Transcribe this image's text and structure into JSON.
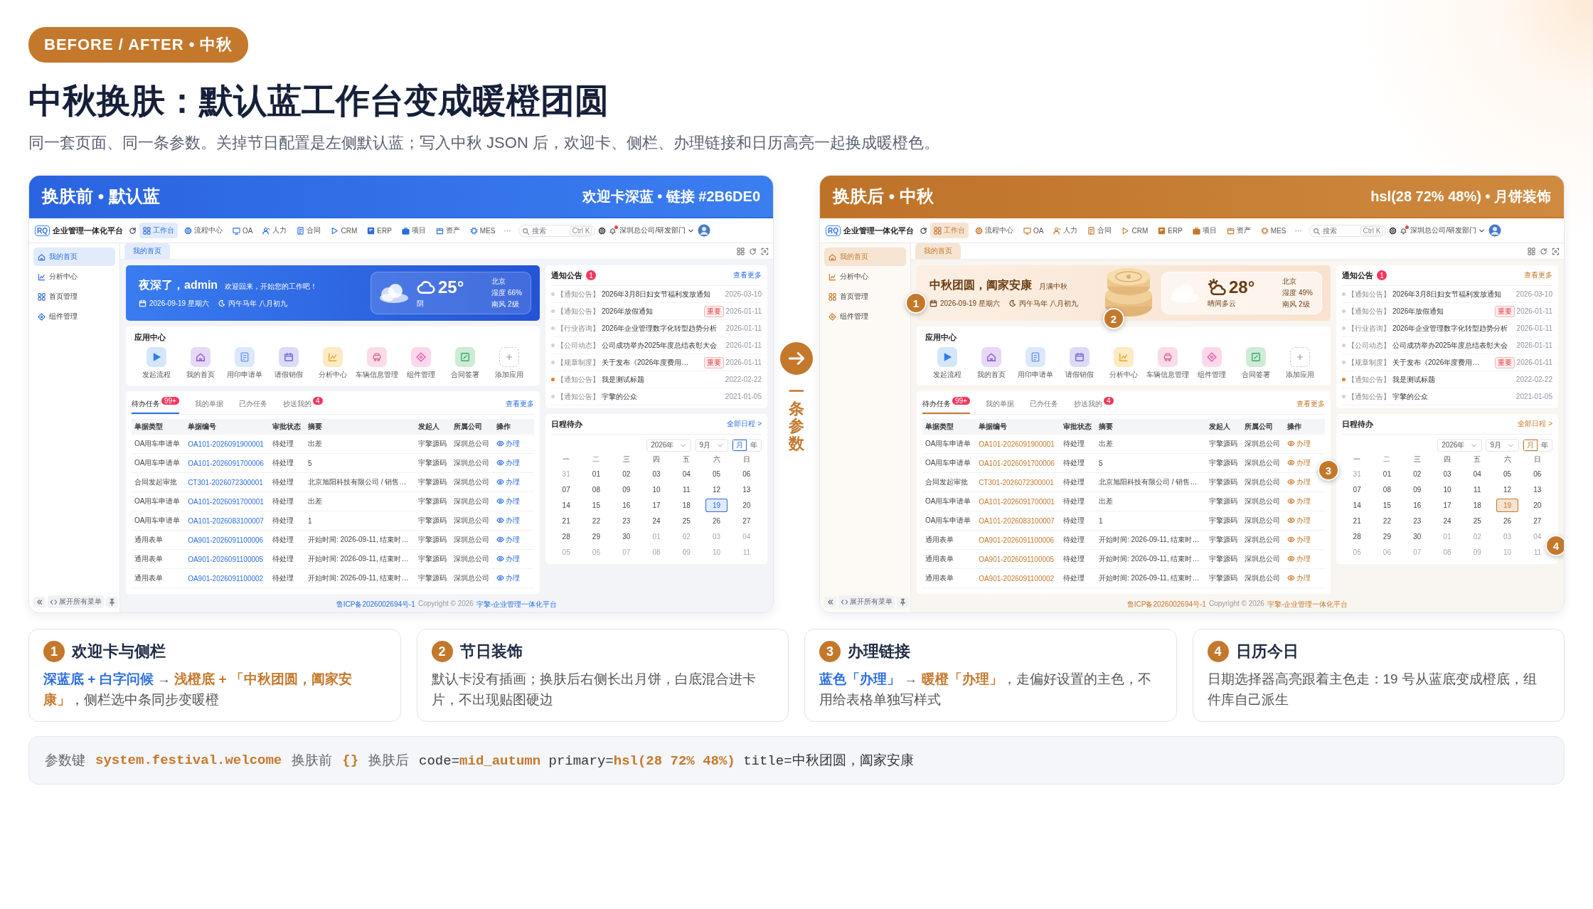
{
  "badge": "BEFORE / AFTER • 中秋",
  "title": "中秋换肤：默认蓝工作台变成暖橙团圆",
  "subtitle": "同一套页面、同一条参数。关掉节日配置是左侧默认蓝；写入中秋 JSON 后，欢迎卡、侧栏、办理链接和日历高亮一起换成暖橙色。",
  "connector": {
    "label": "一条参数"
  },
  "panels": [
    {
      "kind": "default",
      "header": {
        "title": "换肤前 • 默认蓝",
        "note": "欢迎卡深蓝 • 链接 #2B6DE0"
      },
      "app": {
        "logo": "RQ",
        "name": "企业管理一体化平台",
        "nav": [
          {
            "label": "工作台",
            "selected": true
          },
          {
            "label": "流程中心",
            "selected": false
          },
          {
            "label": "OA",
            "selected": false
          },
          {
            "label": "人力",
            "selected": false
          },
          {
            "label": "合同",
            "selected": false
          },
          {
            "label": "CRM",
            "selected": false
          },
          {
            "label": "ERP",
            "selected": false
          },
          {
            "label": "项目",
            "selected": false
          },
          {
            "label": "资产",
            "selected": false
          },
          {
            "label": "MES",
            "selected": false
          }
        ],
        "more": "···",
        "search": {
          "placeholder": "搜索",
          "shortcut": "Ctrl K"
        },
        "org": "深圳总公司/研发部门",
        "sidebar": [
          {
            "label": "我的首页",
            "selected": true
          },
          {
            "label": "分析中心",
            "selected": false
          },
          {
            "label": "首页管理",
            "selected": false
          },
          {
            "label": "组件管理",
            "selected": false
          }
        ],
        "sidebar_footer": "展开所有菜单",
        "page_tabs": [
          {
            "label": "我的首页",
            "selected": true
          }
        ],
        "welcome": {
          "greeting": "夜深了，admin",
          "message": "欢迎回来，开始您的工作吧！",
          "date": "2026-09-19 星期六",
          "lunar": "丙午马年 八月初九",
          "weather": {
            "kind": "cloudy",
            "temp": "25°",
            "desc": "阴",
            "city": "北京",
            "humidity": "湿度 66%",
            "wind": "南风 2级"
          }
        },
        "apps": {
          "title": "应用中心",
          "items": [
            {
              "label": "发起流程",
              "kind": "app",
              "color": "#d3e6fb"
            },
            {
              "label": "我的首页",
              "kind": "app",
              "color": "#e6d8f6"
            },
            {
              "label": "用印申请单",
              "kind": "app",
              "color": "#dce8fc"
            },
            {
              "label": "请假销假",
              "kind": "app",
              "color": "#dcdaf7"
            },
            {
              "label": "分析中心",
              "kind": "app",
              "color": "#fcebc3"
            },
            {
              "label": "车辆信息管理",
              "kind": "app",
              "color": "#fbdbe7"
            },
            {
              "label": "组件管理",
              "kind": "app",
              "color": "#fbd8ec"
            },
            {
              "label": "合同签署",
              "kind": "app",
              "color": "#cdebd7"
            },
            {
              "label": "添加应用",
              "kind": "add"
            }
          ]
        },
        "tasks": {
          "tabs": [
            {
              "label": "待办任务",
              "badge": "99+",
              "selected": true
            },
            {
              "label": "我的单据",
              "selected": false
            },
            {
              "label": "已办任务",
              "selected": false
            },
            {
              "label": "抄送我的",
              "badge": "4",
              "selected": false
            }
          ],
          "more": "查看更多",
          "columns": [
            "单据类型",
            "单据编号",
            "审批状态",
            "摘要",
            "发起人",
            "所属公司",
            "操作"
          ],
          "rows": [
            {
              "cells": [
                "OA用车申请单",
                "OA101-2026091900001",
                "待处理",
                "出差",
                "宇擎源码",
                "深圳总公司"
              ],
              "action": "办理"
            },
            {
              "cells": [
                "OA用车申请单",
                "OA101-2026091700006",
                "待处理",
                "5",
                "宇擎源码",
                "深圳总公司"
              ],
              "action": "办理"
            },
            {
              "cells": [
                "合同发起审批",
                "CT301-2026072300001",
                "待处理",
                "北京旭阳科技有限公司 / 销售…",
                "宇擎源码",
                "深圳总公司"
              ],
              "action": "办理"
            },
            {
              "cells": [
                "OA用车申请单",
                "OA101-2026091700001",
                "待处理",
                "出差",
                "宇擎源码",
                "深圳总公司"
              ],
              "action": "办理"
            },
            {
              "cells": [
                "OA用车申请单",
                "OA101-2026083100007",
                "待处理",
                "1",
                "宇擎源码",
                "深圳总公司"
              ],
              "action": "办理"
            },
            {
              "cells": [
                "通用表单",
                "OA901-2026091100006",
                "待处理",
                "开始时间: 2026-09-11, 结束时…",
                "宇擎源码",
                "深圳总公司"
              ],
              "action": "办理"
            },
            {
              "cells": [
                "通用表单",
                "OA901-2026091100005",
                "待处理",
                "开始时间: 2026-09-11, 结束时…",
                "宇擎源码",
                "深圳总公司"
              ],
              "action": "办理"
            },
            {
              "cells": [
                "通用表单",
                "OA901-2026091100002",
                "待处理",
                "开始时间: 2026-09-11, 结束时…",
                "宇擎源码",
                "深圳总公司"
              ],
              "action": "办理"
            }
          ]
        },
        "notices": {
          "title": "通知公告",
          "badge": "1",
          "more": "查看更多",
          "items": [
            {
              "category": "【通知公告】",
              "title": "2026年3月8日妇女节福利发放通知",
              "date": "2026-03-10",
              "highlighted": false
            },
            {
              "category": "【通知公告】",
              "title": "2026年放假通知",
              "tag": "重要",
              "date": "2026-01-11",
              "highlighted": false
            },
            {
              "category": "【行业咨询】",
              "title": "2026年企业管理数字化转型趋势分析",
              "date": "2026-01-11",
              "highlighted": false
            },
            {
              "category": "【公司动态】",
              "title": "公司成功举办2025年度总结表彰大会",
              "date": "2026-01-11",
              "highlighted": false
            },
            {
              "category": "【规章制度】",
              "title": "关于发布《2026年度费用…",
              "tag": "重要",
              "date": "2026-01-11",
              "highlighted": false
            },
            {
              "category": "【通知公告】",
              "title": "我是测试标题",
              "date": "2022-02-22",
              "highlighted": true
            },
            {
              "category": "【通知公告】",
              "title": "宇擎的公众",
              "date": "2021-01-05",
              "highlighted": false
            }
          ]
        },
        "calendar": {
          "title": "日程待办",
          "more": "全部日程 >",
          "year": "2026年",
          "month": "9月",
          "modes": [
            {
              "label": "月",
              "selected": true
            },
            {
              "label": "年",
              "selected": false
            }
          ],
          "weekdays": [
            "一",
            "二",
            "三",
            "四",
            "五",
            "六",
            "日"
          ],
          "weeks": [
            [
              {
                "label": "31",
                "muted": true,
                "selected": false
              },
              {
                "label": "01",
                "muted": false,
                "selected": false
              },
              {
                "label": "02",
                "muted": false,
                "selected": false
              },
              {
                "label": "03",
                "muted": false,
                "selected": false
              },
              {
                "label": "04",
                "muted": false,
                "selected": false
              },
              {
                "label": "05",
                "muted": false,
                "selected": false
              },
              {
                "label": "06",
                "muted": false,
                "selected": false
              }
            ],
            [
              {
                "label": "07",
                "muted": false,
                "selected": false
              },
              {
                "label": "08",
                "muted": false,
                "selected": false
              },
              {
                "label": "09",
                "muted": false,
                "selected": false
              },
              {
                "label": "10",
                "muted": false,
                "selected": false
              },
              {
                "label": "11",
                "muted": false,
                "selected": false
              },
              {
                "label": "12",
                "muted": false,
                "selected": false
              },
              {
                "label": "13",
                "muted": false,
                "selected": false
              }
            ],
            [
              {
                "label": "14",
                "muted": false,
                "selected": false
              },
              {
                "label": "15",
                "muted": false,
                "selected": false
              },
              {
                "label": "16",
                "muted": false,
                "selected": false
              },
              {
                "label": "17",
                "muted": false,
                "selected": false
              },
              {
                "label": "18",
                "muted": false,
                "selected": false
              },
              {
                "label": "19",
                "muted": false,
                "selected": true
              },
              {
                "label": "20",
                "muted": false,
                "selected": false
              }
            ],
            [
              {
                "label": "21",
                "muted": false,
                "selected": false
              },
              {
                "label": "22",
                "muted": false,
                "selected": false
              },
              {
                "label": "23",
                "muted": false,
                "selected": false
              },
              {
                "label": "24",
                "muted": false,
                "selected": false
              },
              {
                "label": "25",
                "muted": false,
                "selected": false
              },
              {
                "label": "26",
                "muted": false,
                "selected": false
              },
              {
                "label": "27",
                "muted": false,
                "selected": false
              }
            ],
            [
              {
                "label": "28",
                "muted": false,
                "selected": false
              },
              {
                "label": "29",
                "muted": false,
                "selected": false
              },
              {
                "label": "30",
                "muted": false,
                "selected": false
              },
              {
                "label": "01",
                "muted": true,
                "selected": false
              },
              {
                "label": "02",
                "muted": true,
                "selected": false
              },
              {
                "label": "03",
                "muted": true,
                "selected": false
              },
              {
                "label": "04",
                "muted": true,
                "selected": false
              }
            ],
            [
              {
                "label": "05",
                "muted": true,
                "selected": false
              },
              {
                "label": "06",
                "muted": true,
                "selected": false
              },
              {
                "label": "07",
                "muted": true,
                "selected": false
              },
              {
                "label": "08",
                "muted": true,
                "selected": false
              },
              {
                "label": "09",
                "muted": true,
                "selected": false
              },
              {
                "label": "10",
                "muted": true,
                "selected": false
              },
              {
                "label": "11",
                "muted": true,
                "selected": false
              }
            ]
          ]
        },
        "footer": {
          "icp": "鲁ICP备2026002694号-1",
          "copyright": "Copyright © 2026",
          "site": "宇擎-企业管理一体化平台"
        }
      }
    },
    {
      "kind": "festival",
      "header": {
        "title": "换肤后 • 中秋",
        "note": "hsl(28 72% 48%) • 月饼装饰"
      },
      "app": {
        "logo": "RQ",
        "name": "企业管理一体化平台",
        "nav": [
          {
            "label": "工作台",
            "selected": true
          },
          {
            "label": "流程中心",
            "selected": false
          },
          {
            "label": "OA",
            "selected": false
          },
          {
            "label": "人力",
            "selected": false
          },
          {
            "label": "合同",
            "selected": false
          },
          {
            "label": "CRM",
            "selected": false
          },
          {
            "label": "ERP",
            "selected": false
          },
          {
            "label": "项目",
            "selected": false
          },
          {
            "label": "资产",
            "selected": false
          },
          {
            "label": "MES",
            "selected": false
          }
        ],
        "more": "···",
        "search": {
          "placeholder": "搜索",
          "shortcut": "Ctrl K"
        },
        "org": "深圳总公司/研发部门",
        "sidebar": [
          {
            "label": "我的首页",
            "selected": true
          },
          {
            "label": "分析中心",
            "selected": false
          },
          {
            "label": "首页管理",
            "selected": false
          },
          {
            "label": "组件管理",
            "selected": false
          }
        ],
        "sidebar_footer": "展开所有菜单",
        "page_tabs": [
          {
            "label": "我的首页",
            "selected": true
          }
        ],
        "welcome": {
          "greeting": "中秋团圆，阖家安康",
          "message": "月满中秋",
          "date": "2026-09-19 星期六",
          "lunar": "丙午马年 八月初九",
          "marker": "1",
          "illustration": {
            "kind": "mooncake",
            "marker": "2"
          },
          "weather": {
            "kind": "partly_sunny",
            "temp": "28°",
            "desc": "晴间多云",
            "city": "北京",
            "humidity": "湿度 49%",
            "wind": "南风 2级"
          }
        },
        "apps": {
          "title": "应用中心",
          "items": [
            {
              "label": "发起流程",
              "kind": "app",
              "color": "#d3e6fb"
            },
            {
              "label": "我的首页",
              "kind": "app",
              "color": "#e6d8f6"
            },
            {
              "label": "用印申请单",
              "kind": "app",
              "color": "#dce8fc"
            },
            {
              "label": "请假销假",
              "kind": "app",
              "color": "#dcdaf7"
            },
            {
              "label": "分析中心",
              "kind": "app",
              "color": "#fcebc3"
            },
            {
              "label": "车辆信息管理",
              "kind": "app",
              "color": "#fbdbe7"
            },
            {
              "label": "组件管理",
              "kind": "app",
              "color": "#fbd8ec"
            },
            {
              "label": "合同签署",
              "kind": "app",
              "color": "#cdebd7"
            },
            {
              "label": "添加应用",
              "kind": "add"
            }
          ]
        },
        "tasks": {
          "tabs": [
            {
              "label": "待办任务",
              "badge": "99+",
              "selected": true
            },
            {
              "label": "我的单据",
              "selected": false
            },
            {
              "label": "已办任务",
              "selected": false
            },
            {
              "label": "抄送我的",
              "badge": "4",
              "selected": false
            }
          ],
          "more": "查看更多",
          "marker": "3",
          "columns": [
            "单据类型",
            "单据编号",
            "审批状态",
            "摘要",
            "发起人",
            "所属公司",
            "操作"
          ],
          "rows": [
            {
              "cells": [
                "OA用车申请单",
                "OA101-2026091900001",
                "待处理",
                "出差",
                "宇擎源码",
                "深圳总公司"
              ],
              "action": "办理"
            },
            {
              "cells": [
                "OA用车申请单",
                "OA101-2026091700006",
                "待处理",
                "5",
                "宇擎源码",
                "深圳总公司"
              ],
              "action": "办理"
            },
            {
              "cells": [
                "合同发起审批",
                "CT301-2026072300001",
                "待处理",
                "北京旭阳科技有限公司 / 销售…",
                "宇擎源码",
                "深圳总公司"
              ],
              "action": "办理"
            },
            {
              "cells": [
                "OA用车申请单",
                "OA101-2026091700001",
                "待处理",
                "出差",
                "宇擎源码",
                "深圳总公司"
              ],
              "action": "办理"
            },
            {
              "cells": [
                "OA用车申请单",
                "OA101-2026083100007",
                "待处理",
                "1",
                "宇擎源码",
                "深圳总公司"
              ],
              "action": "办理"
            },
            {
              "cells": [
                "通用表单",
                "OA901-2026091100006",
                "待处理",
                "开始时间: 2026-09-11, 结束时…",
                "宇擎源码",
                "深圳总公司"
              ],
              "action": "办理"
            },
            {
              "cells": [
                "通用表单",
                "OA901-2026091100005",
                "待处理",
                "开始时间: 2026-09-11, 结束时…",
                "宇擎源码",
                "深圳总公司"
              ],
              "action": "办理"
            },
            {
              "cells": [
                "通用表单",
                "OA901-2026091100002",
                "待处理",
                "开始时间: 2026-09-11, 结束时…",
                "宇擎源码",
                "深圳总公司"
              ],
              "action": "办理"
            }
          ]
        },
        "notices": {
          "title": "通知公告",
          "badge": "1",
          "more": "查看更多",
          "items": [
            {
              "category": "【通知公告】",
              "title": "2026年3月8日妇女节福利发放通知",
              "date": "2026-03-10",
              "highlighted": false
            },
            {
              "category": "【通知公告】",
              "title": "2026年放假通知",
              "tag": "重要",
              "date": "2026-01-11",
              "highlighted": false
            },
            {
              "category": "【行业咨询】",
              "title": "2026年企业管理数字化转型趋势分析",
              "date": "2026-01-11",
              "highlighted": false
            },
            {
              "category": "【公司动态】",
              "title": "公司成功举办2025年度总结表彰大会",
              "date": "2026-01-11",
              "highlighted": false
            },
            {
              "category": "【规章制度】",
              "title": "关于发布《2026年度费用…",
              "tag": "重要",
              "date": "2026-01-11",
              "highlighted": false
            },
            {
              "category": "【通知公告】",
              "title": "我是测试标题",
              "date": "2022-02-22",
              "highlighted": true
            },
            {
              "category": "【通知公告】",
              "title": "宇擎的公众",
              "date": "2021-01-05",
              "highlighted": false
            }
          ]
        },
        "calendar": {
          "title": "日程待办",
          "more": "全部日程 >",
          "year": "2026年",
          "month": "9月",
          "marker": "4",
          "modes": [
            {
              "label": "月",
              "selected": true
            },
            {
              "label": "年",
              "selected": false
            }
          ],
          "weekdays": [
            "一",
            "二",
            "三",
            "四",
            "五",
            "六",
            "日"
          ],
          "weeks": [
            [
              {
                "label": "31",
                "muted": true,
                "selected": false
              },
              {
                "label": "01",
                "muted": false,
                "selected": false
              },
              {
                "label": "02",
                "muted": false,
                "selected": false
              },
              {
                "label": "03",
                "muted": false,
                "selected": false
              },
              {
                "label": "04",
                "muted": false,
                "selected": false
              },
              {
                "label": "05",
                "muted": false,
                "selected": false
              },
              {
                "label": "06",
                "muted": false,
                "selected": false
              }
            ],
            [
              {
                "label": "07",
                "muted": false,
                "selected": false
              },
              {
                "label": "08",
                "muted": false,
                "selected": false
              },
              {
                "label": "09",
                "muted": false,
                "selected": false
              },
              {
                "label": "10",
                "muted": false,
                "selected": false
              },
              {
                "label": "11",
                "muted": false,
                "selected": false
              },
              {
                "label": "12",
                "muted": false,
                "selected": false
              },
              {
                "label": "13",
                "muted": false,
                "selected": false
              }
            ],
            [
              {
                "label": "14",
                "muted": false,
                "selected": false
              },
              {
                "label": "15",
                "muted": false,
                "selected": false
              },
              {
                "label": "16",
                "muted": false,
                "selected": false
              },
              {
                "label": "17",
                "muted": false,
                "selected": false
              },
              {
                "label": "18",
                "muted": false,
                "selected": false
              },
              {
                "label": "19",
                "muted": false,
                "selected": true
              },
              {
                "label": "20",
                "muted": false,
                "selected": false
              }
            ],
            [
              {
                "label": "21",
                "muted": false,
                "selected": false
              },
              {
                "label": "22",
                "muted": false,
                "selected": false
              },
              {
                "label": "23",
                "muted": false,
                "selected": false
              },
              {
                "label": "24",
                "muted": false,
                "selected": false
              },
              {
                "label": "25",
                "muted": false,
                "selected": false
              },
              {
                "label": "26",
                "muted": false,
                "selected": false
              },
              {
                "label": "27",
                "muted": false,
                "selected": false
              }
            ],
            [
              {
                "label": "28",
                "muted": false,
                "selected": false
              },
              {
                "label": "29",
                "muted": false,
                "selected": false
              },
              {
                "label": "30",
                "muted": false,
                "selected": false
              },
              {
                "label": "01",
                "muted": true,
                "selected": false
              },
              {
                "label": "02",
                "muted": true,
                "selected": false
              },
              {
                "label": "03",
                "muted": true,
                "selected": false
              },
              {
                "label": "04",
                "muted": true,
                "selected": false
              }
            ],
            [
              {
                "label": "05",
                "muted": true,
                "selected": false
              },
              {
                "label": "06",
                "muted": true,
                "selected": false
              },
              {
                "label": "07",
                "muted": true,
                "selected": false
              },
              {
                "label": "08",
                "muted": true,
                "selected": false
              },
              {
                "label": "09",
                "muted": true,
                "selected": false
              },
              {
                "label": "10",
                "muted": true,
                "selected": false
              },
              {
                "label": "11",
                "muted": true,
                "selected": false
              }
            ]
          ]
        },
        "footer": {
          "icp": "鲁ICP备2026002694号-1",
          "copyright": "Copyright © 2026",
          "site": "宇擎-企业管理一体化平台"
        }
      }
    }
  ],
  "notes": [
    {
      "number": "1",
      "title": "欢迎卡与侧栏",
      "text": "**深蓝底 + 白字问候** → **浅橙底 + 「中秋团圆，阖家安康」**，侧栏选中条同步变暖橙"
    },
    {
      "number": "2",
      "title": "节日装饰",
      "text": "默认卡没有插画；换肤后右侧长出月饼，白底混合进卡片，不出现贴图硬边"
    },
    {
      "number": "3",
      "title": "办理链接",
      "text": "**蓝色「办理」** → **暖橙「办理」**，走偏好设置的主色，不用给表格单独写样式"
    },
    {
      "number": "4",
      "title": "日历今日",
      "text": "日期选择器高亮跟着主色走：19 号从蓝底变成橙底，组件库自己派生"
    }
  ],
  "params": [
    {
      "label": "参数键",
      "value": "system.festival.welcome",
      "highlight": true
    },
    {
      "label": "换肤前",
      "value": "{}",
      "highlight": true
    },
    {
      "label": "换肤后",
      "value": "code=**mid_autumn** primary=**hsl(28 72% 48%)** title=中秋团圆，阖家安康",
      "highlight": false
    }
  ]
}
